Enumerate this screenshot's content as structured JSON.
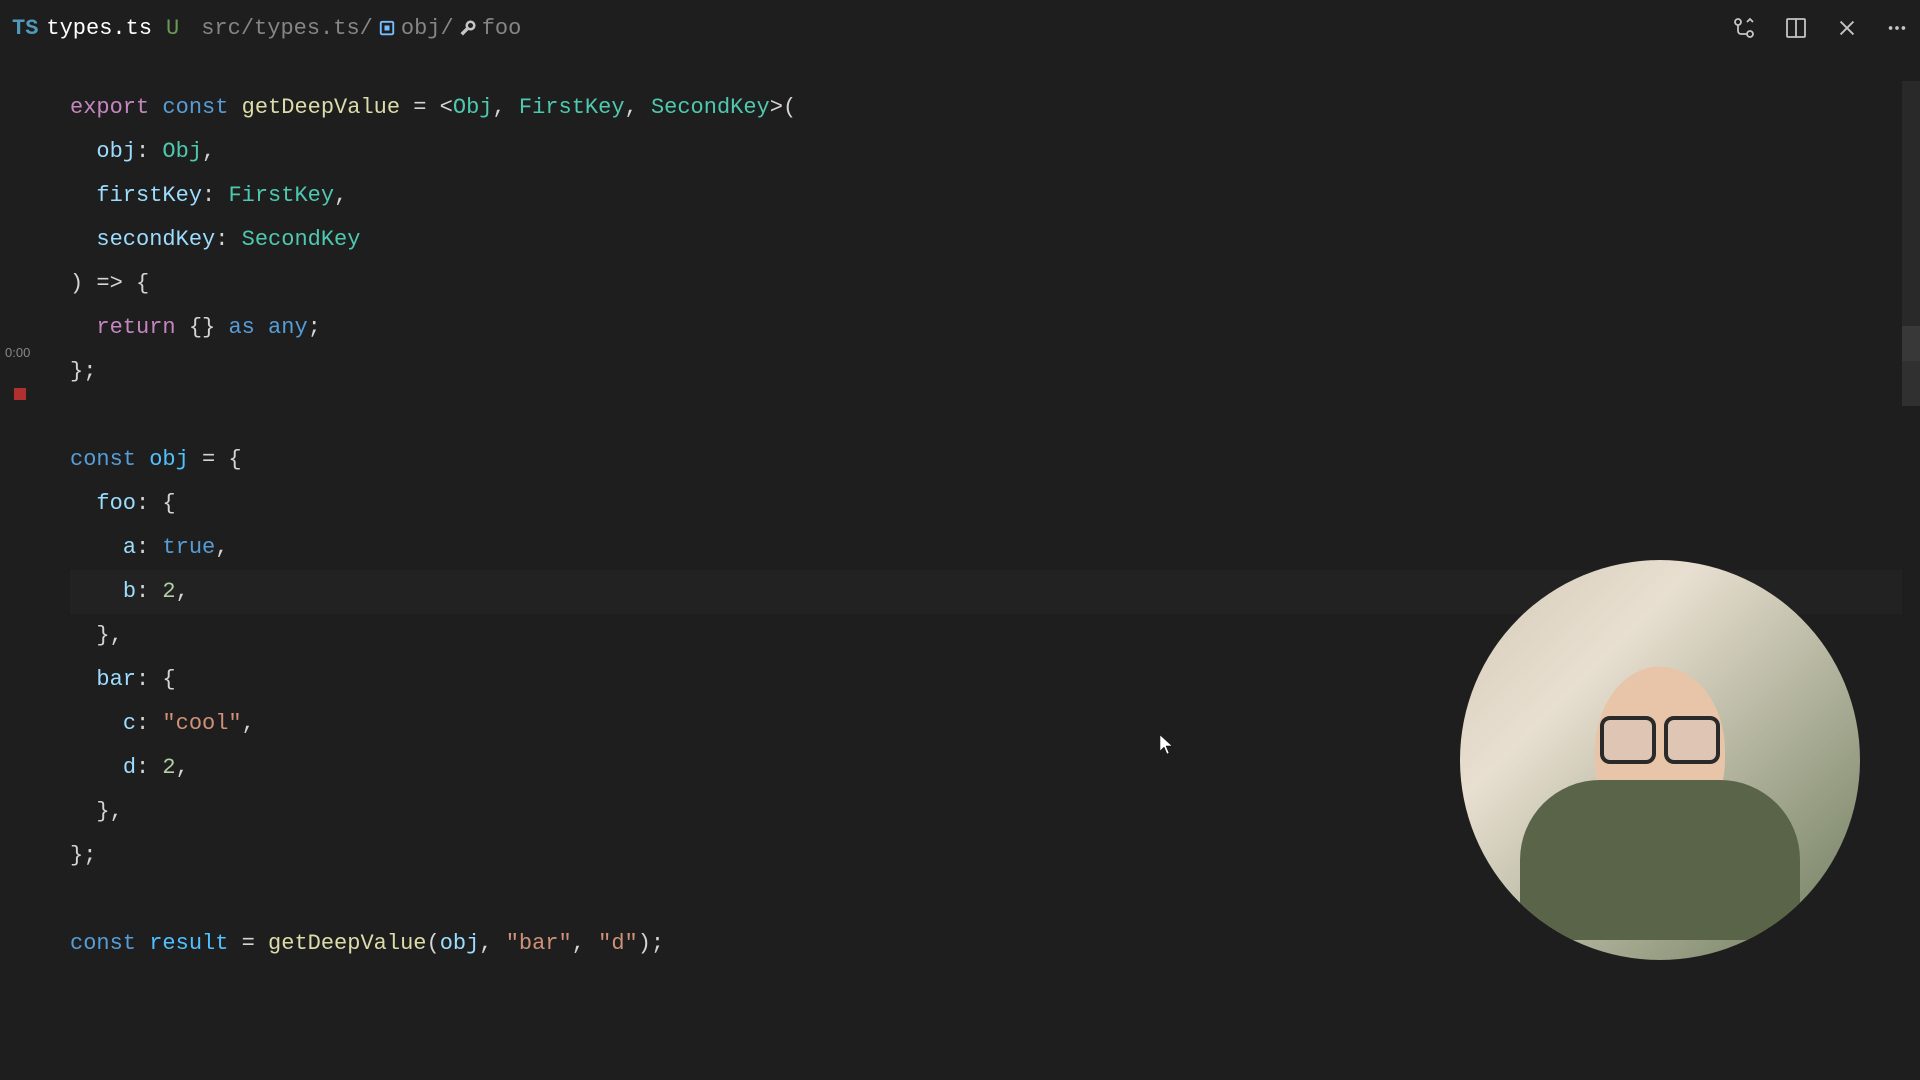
{
  "tab": {
    "file_type": "TS",
    "filename": "types.ts",
    "modified_marker": "U",
    "breadcrumb_path": "src/types.ts/",
    "breadcrumb_obj": "obj/",
    "breadcrumb_foo": "foo"
  },
  "timestamp": "0:00",
  "code": {
    "l1_export": "export",
    "l1_const": "const",
    "l1_fn": "getDeepValue",
    "l1_eq": " = <",
    "l1_t1": "Obj",
    "l1_c1": ", ",
    "l1_t2": "FirstKey",
    "l1_c2": ", ",
    "l1_t3": "SecondKey",
    "l1_end": ">(",
    "l2_p": "obj",
    "l2_col": ": ",
    "l2_t": "Obj",
    "l2_end": ",",
    "l3_p": "firstKey",
    "l3_col": ": ",
    "l3_t": "FirstKey",
    "l3_end": ",",
    "l4_p": "secondKey",
    "l4_col": ": ",
    "l4_t": "SecondKey",
    "l5": ") => {",
    "l6_ret": "return",
    "l6_obj": " {} ",
    "l6_as": "as",
    "l6_sp": " ",
    "l6_any": "any",
    "l6_end": ";",
    "l7": "};",
    "l9_const": "const",
    "l9_var": "obj",
    "l9_eq": " = {",
    "l10_p": "foo",
    "l10_end": ": {",
    "l11_p": "a",
    "l11_col": ": ",
    "l11_v": "true",
    "l11_end": ",",
    "l12_p": "b",
    "l12_col": ": ",
    "l12_v": "2",
    "l12_end": ",",
    "l13": "},",
    "l14_p": "bar",
    "l14_end": ": {",
    "l15_p": "c",
    "l15_col": ": ",
    "l15_v": "\"cool\"",
    "l15_end": ",",
    "l16_p": "d",
    "l16_col": ": ",
    "l16_v": "2",
    "l16_end": ",",
    "l17": "},",
    "l18": "};",
    "l20_const": "const",
    "l20_var": "result",
    "l20_eq": " = ",
    "l20_fn": "getDeepValue",
    "l20_op": "(",
    "l20_a1": "obj",
    "l20_c1": ", ",
    "l20_a2": "\"bar\"",
    "l20_c2": ", ",
    "l20_a3": "\"d\"",
    "l20_end": ");"
  }
}
